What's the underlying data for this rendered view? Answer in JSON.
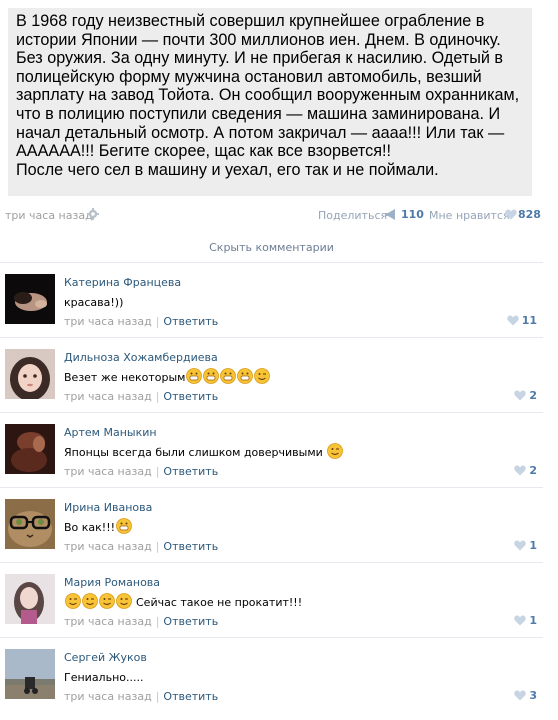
{
  "post": {
    "text": "В 1968 году неизвестный совершил крупнейшее ограбление в\nистории Японии — почти 300 миллионов иен. Днем. В одиночку.\nБез оружия. За одну минуту. И не прибегая к насилию. Одетый в\nполицейскую форму мужчина остановил автомобиль, везший\nзарплату на завод Тойота. Он сообщил вооруженным охранникам,\nчто в полицию поступили сведения — машина заминирована. И\nначал детальный осмотр. А потом закричал — аааа!!! Или так —\nАААААА!!! Бегите скорее, щас как все взорвется!!\nПосле чего сел в машину и уехал, его так и не поймали.",
    "time": "три часа назад",
    "share_label": "Поделиться",
    "share_count": "110",
    "likes_label": "Мне нравится",
    "likes_count": "828"
  },
  "hide_comments_label": "Скрыть комментарии",
  "comments": [
    {
      "name": "Катерина Францева",
      "text": "красава!))",
      "time": "три часа назад",
      "reply": "Ответить",
      "likes": "11",
      "emoji": []
    },
    {
      "name": "Дильноза Хожамбердиева",
      "text": "Везет же некоторым",
      "time": "три часа назад",
      "reply": "Ответить",
      "likes": "2",
      "emoji": [
        "grin",
        "grin",
        "grin",
        "grin",
        "wink"
      ]
    },
    {
      "name": "Артем Маныкин",
      "text": "Японцы всегда были слишком доверчивыми",
      "time": "три часа назад",
      "reply": "Ответить",
      "likes": "2",
      "emoji": [
        "wink"
      ]
    },
    {
      "name": "Ирина Иванова",
      "text": "Во как!!!",
      "time": "три часа назад",
      "reply": "Ответить",
      "likes": "1",
      "emoji": [
        "grin"
      ]
    },
    {
      "name": "Мария Романова",
      "text": "Сейчас такое не прокатит!!!",
      "time": "три часа назад",
      "reply": "Ответить",
      "likes": "1",
      "emoji_before": [
        "wink",
        "wink",
        "wink",
        "wink"
      ]
    },
    {
      "name": "Сергей Жуков",
      "text": "Гениально.....",
      "time": "три часа назад",
      "reply": "Ответить",
      "likes": "3",
      "emoji": []
    }
  ],
  "colors": {
    "link": "#2b587a",
    "muted": "#a0a0a0",
    "count": "#4f7aa8",
    "post_bg": "#ededed"
  }
}
